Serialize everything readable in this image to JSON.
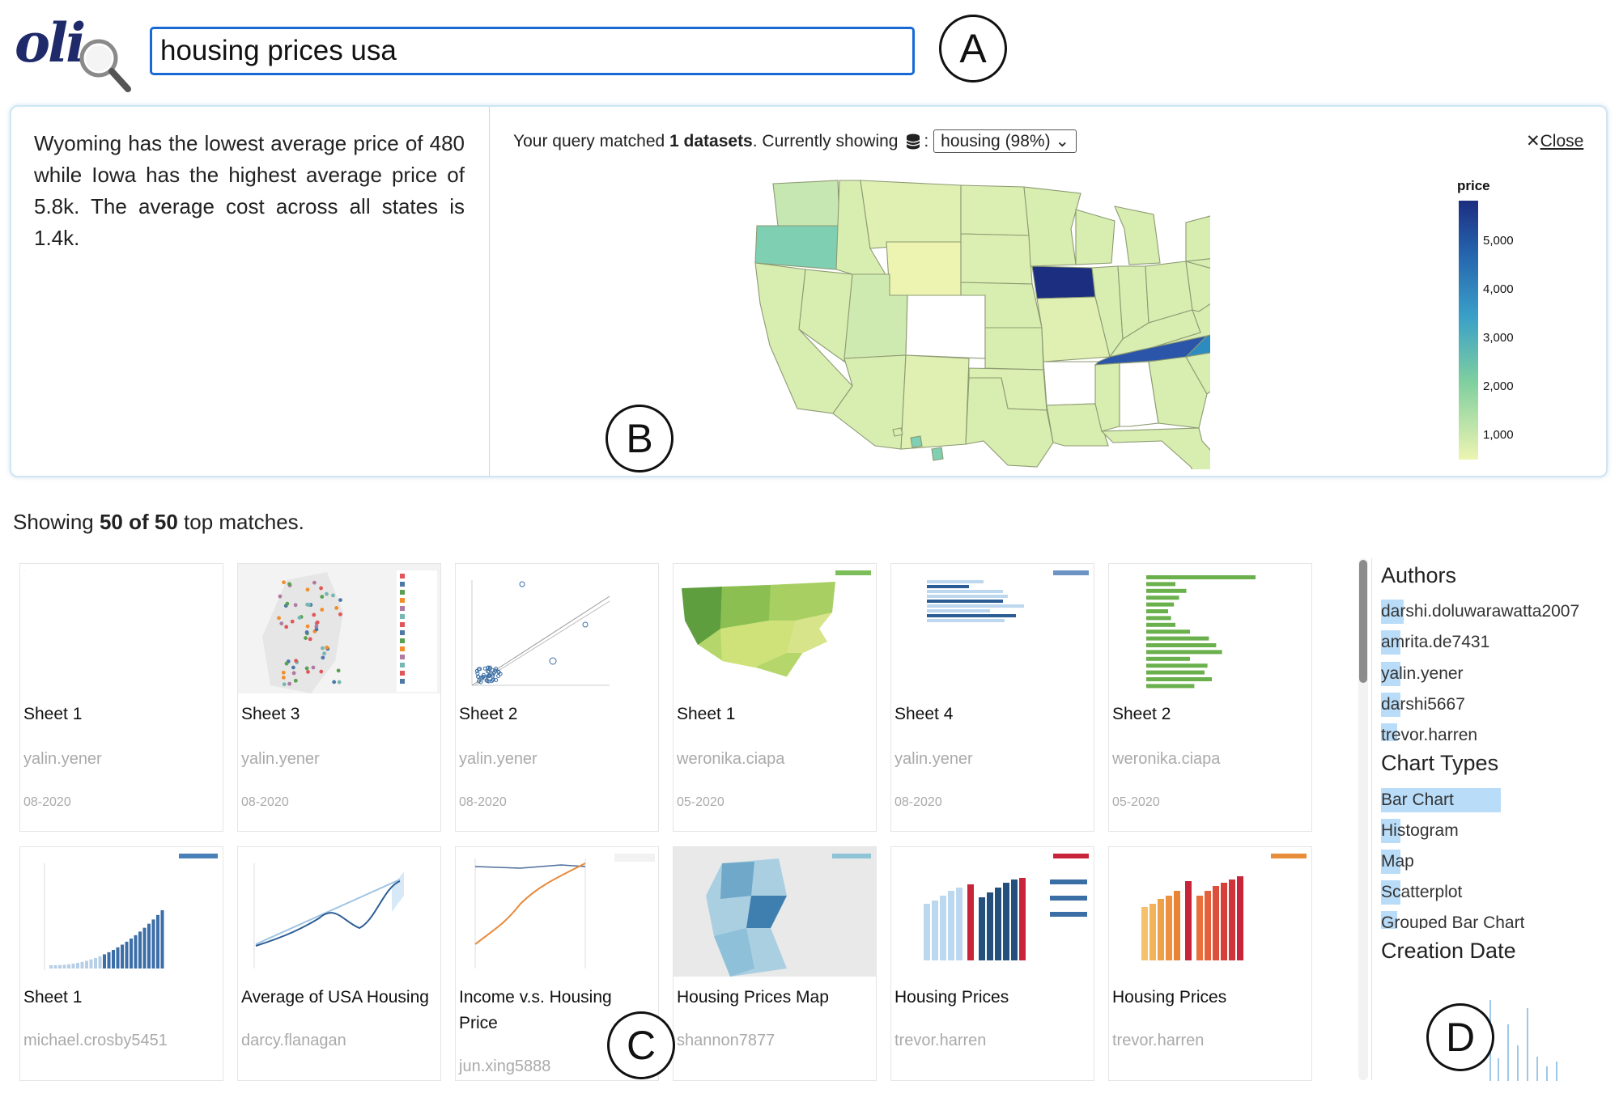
{
  "app": {
    "logo_text": "oli"
  },
  "search": {
    "value": "housing prices usa"
  },
  "markers": {
    "a": "A",
    "b": "B",
    "c": "C",
    "d": "D"
  },
  "summary": {
    "text": "Wyoming has the lowest average price of 480 while Iowa has the highest average price of 5.8k. The average cost across all states is 1.4k."
  },
  "query_info": {
    "prefix": "Your query matched ",
    "count": "1 datasets",
    "middle": ". Currently showing ",
    "dataset": "housing (98%)",
    "close": "Close"
  },
  "legend": {
    "title": "price",
    "ticks": [
      "5,000",
      "4,000",
      "3,000",
      "2,000",
      "1,000"
    ]
  },
  "results": {
    "prefix": "Showing ",
    "count": "50 of 50",
    "suffix": " top matches."
  },
  "cards": [
    {
      "title": "Sheet 1",
      "author": "yalin.yener",
      "date": "08-2020",
      "thumb": "blank"
    },
    {
      "title": "Sheet 3",
      "author": "yalin.yener",
      "date": "08-2020",
      "thumb": "dotmap"
    },
    {
      "title": "Sheet 2",
      "author": "yalin.yener",
      "date": "08-2020",
      "thumb": "scatter"
    },
    {
      "title": "Sheet 1",
      "author": "weronika.ciapa",
      "date": "05-2020",
      "thumb": "usmap"
    },
    {
      "title": "Sheet 4",
      "author": "yalin.yener",
      "date": "08-2020",
      "thumb": "hbars"
    },
    {
      "title": "Sheet 2",
      "author": "weronika.ciapa",
      "date": "05-2020",
      "thumb": "greenbars"
    },
    {
      "title": "Sheet 1",
      "author": "michael.crosby5451",
      "date": "",
      "thumb": "bluebars"
    },
    {
      "title": "Average of USA Housing",
      "author": "darcy.flanagan",
      "date": "",
      "thumb": "trendline"
    },
    {
      "title": "Income v.s. Housing Price",
      "author": "jun.xing5888",
      "date": "",
      "thumb": "orangeline"
    },
    {
      "title": "Housing Prices Map",
      "author": "shannon7877",
      "date": "",
      "thumb": "seattlemap"
    },
    {
      "title": "Housing Prices",
      "author": "trevor.harren",
      "date": "",
      "thumb": "bluebarsred"
    },
    {
      "title": "Housing Prices",
      "author": "trevor.harren",
      "date": "",
      "thumb": "orangebarsred"
    }
  ],
  "sidebar": {
    "authors_title": "Authors",
    "authors": [
      "darshi.doluwarawatta2007",
      "amrita.de7431",
      "yalin.yener",
      "darshi5667",
      "trevor.harren"
    ],
    "chart_types_title": "Chart Types",
    "chart_types": [
      "Bar Chart",
      "Histogram",
      "Map",
      "Scatterplot",
      "Grouped Bar Chart"
    ],
    "creation_date_title": "Creation Date"
  }
}
